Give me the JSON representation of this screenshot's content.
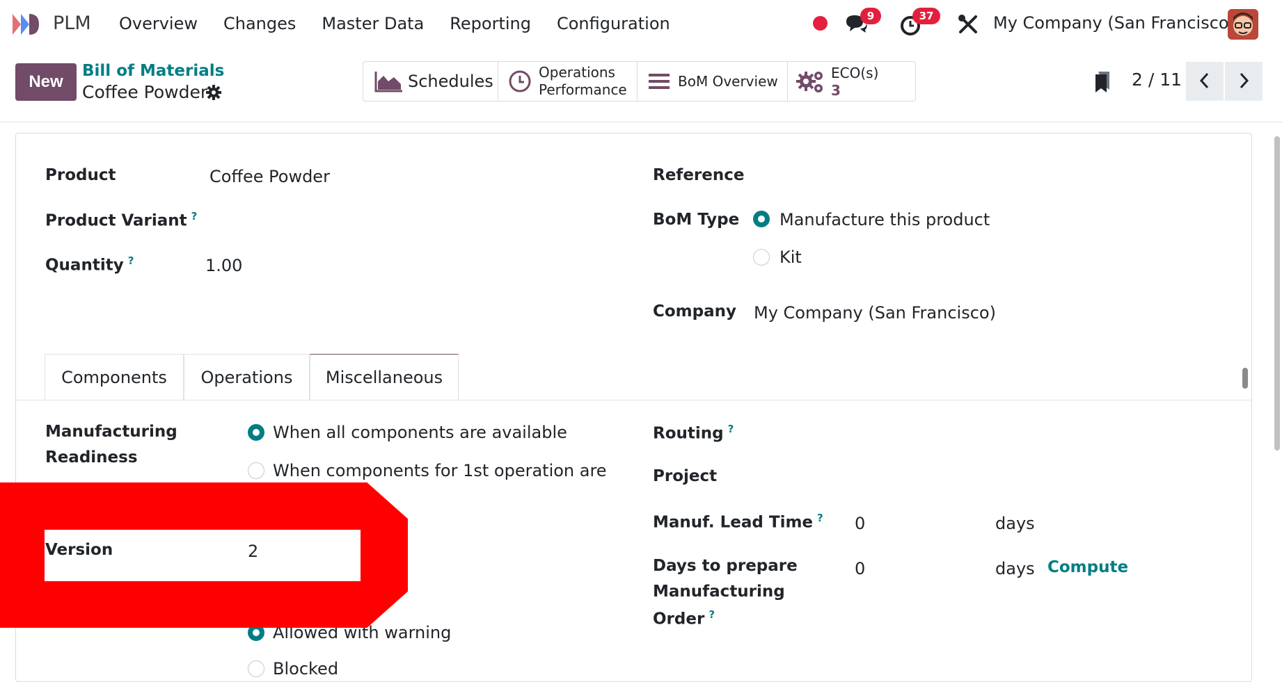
{
  "navbar": {
    "app_name": "PLM",
    "menu": [
      "Overview",
      "Changes",
      "Master Data",
      "Reporting",
      "Configuration"
    ],
    "messages_count": "9",
    "activities_count": "37",
    "company": "My Company (San Francisco)"
  },
  "control": {
    "new_label": "New",
    "breadcrumb_parent": "Bill of Materials",
    "breadcrumb_current": "Coffee Powder",
    "smart_buttons": {
      "schedules": "Schedules",
      "ops_perf_line1": "Operations",
      "ops_perf_line2": "Performance",
      "bom_overview": "BoM Overview",
      "eco_label": "ECO(s)",
      "eco_count": "3"
    },
    "pager": "2 / 11"
  },
  "form": {
    "product_label": "Product",
    "product_value": "Coffee Powder",
    "variant_label": "Product Variant",
    "quantity_label": "Quantity",
    "quantity_value": "1.00",
    "reference_label": "Reference",
    "bom_type_label": "BoM Type",
    "bom_type_options": [
      "Manufacture this product",
      "Kit"
    ],
    "company_label": "Company",
    "company_value": "My Company (San Francisco)",
    "help_mark": "?"
  },
  "tabs": [
    "Components",
    "Operations",
    "Miscellaneous"
  ],
  "misc": {
    "readiness_label_1": "Manufacturing",
    "readiness_label_2": "Readiness",
    "readiness_options": [
      "When all components are available",
      "When components for 1st operation are"
    ],
    "version_label": "Version",
    "version_value": "2",
    "consumption_options": [
      "Allowed with warning",
      "Blocked"
    ],
    "routing_label": "Routing",
    "project_label": "Project",
    "lead_time_label": "Manuf. Lead Time",
    "lead_time_value": "0",
    "days_unit": "days",
    "prepare_label_1": "Days to prepare",
    "prepare_label_2": "Manufacturing",
    "prepare_label_3": "Order",
    "prepare_value": "0",
    "compute_label": "Compute"
  },
  "colors": {
    "brand": "#714b67",
    "accent": "#017e84",
    "badge": "#e41f3d",
    "annotation": "#ff0000"
  }
}
